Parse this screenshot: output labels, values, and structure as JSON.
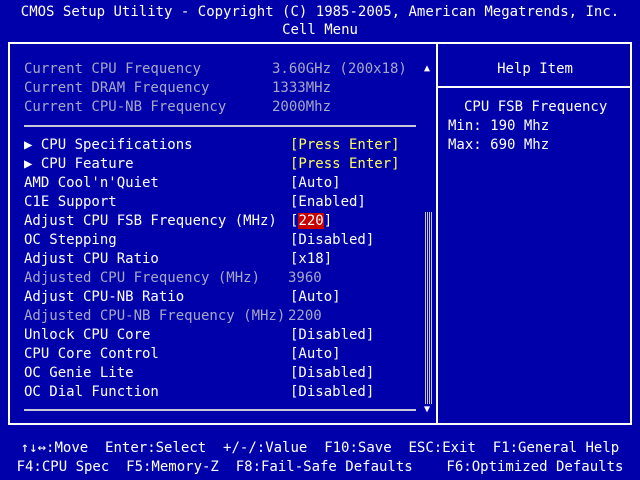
{
  "header": {
    "title": "CMOS Setup Utility - Copyright (C) 1985-2005, American Megatrends, Inc.",
    "subtitle": "Cell Menu"
  },
  "info": [
    {
      "label": "Current CPU Frequency",
      "value": "3.60GHz (200x18)"
    },
    {
      "label": "Current DRAM Frequency",
      "value": "1333MHz"
    },
    {
      "label": "Current CPU-NB Frequency",
      "value": "2000Mhz"
    }
  ],
  "menu": [
    {
      "label": "▶ CPU Specifications",
      "value": "[Press Enter]"
    },
    {
      "label": "▶ CPU Feature",
      "value": "[Press Enter]"
    },
    {
      "label": "AMD Cool'n'Quiet",
      "value": "[Auto]"
    },
    {
      "label": "C1E Support",
      "value": "[Enabled]"
    },
    {
      "label": "Adjust CPU FSB Frequency (MHz)",
      "value": "220"
    },
    {
      "label": "OC Stepping",
      "value": "[Disabled]"
    },
    {
      "label": "Adjust CPU Ratio",
      "value": "[x18]"
    },
    {
      "label": "Adjusted CPU Frequency (MHz)",
      "value": "3960"
    },
    {
      "label": "Adjust CPU-NB Ratio",
      "value": "[Auto]"
    },
    {
      "label": "Adjusted CPU-NB Frequency (MHz)",
      "value": "2200"
    },
    {
      "label": "Unlock CPU Core",
      "value": "[Disabled]"
    },
    {
      "label": "CPU Core Control",
      "value": "[Auto]"
    },
    {
      "label": "OC Genie Lite",
      "value": "[Disabled]"
    },
    {
      "label": "OC Dial Function",
      "value": "[Disabled]"
    }
  ],
  "scroll": {
    "up": "▲",
    "down": "▼"
  },
  "help": {
    "title": "Help Item",
    "topic": "CPU FSB Frequency",
    "min": "Min: 190 Mhz",
    "max": "Max: 690 Mhz"
  },
  "footer": {
    "line1": "↑↓↔:Move  Enter:Select  +/-/:Value  F10:Save  ESC:Exit  F1:General Help",
    "line2": "F4:CPU Spec  F5:Memory-Z  F8:Fail-Safe Defaults    F6:Optimized Defaults"
  },
  "colors": {
    "background": "#0000aa",
    "text": "#ffffff",
    "disabled_text": "#a7a7c7",
    "submenu_value": "#ffff55",
    "selection": "#c80000"
  }
}
